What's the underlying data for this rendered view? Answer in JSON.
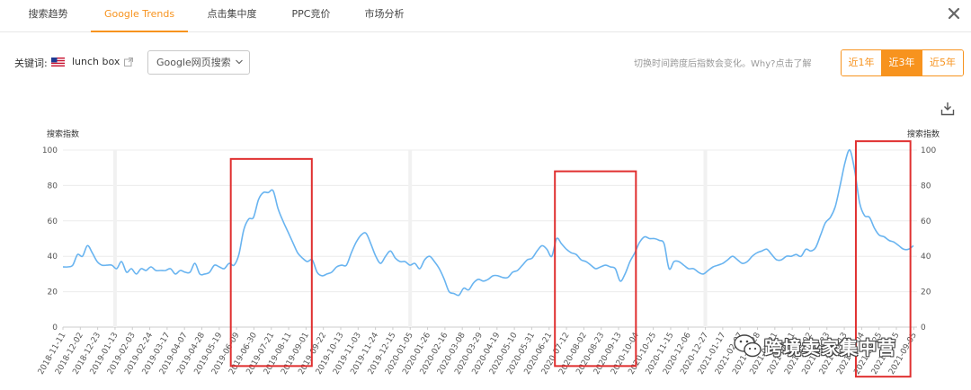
{
  "tabs": [
    {
      "label": "搜索趋势",
      "active": false
    },
    {
      "label": "Google Trends",
      "active": true
    },
    {
      "label": "点击集中度",
      "active": false
    },
    {
      "label": "PPC竞价",
      "active": false
    },
    {
      "label": "市场分析",
      "active": false
    }
  ],
  "toolbar": {
    "keyword_label": "关键词:",
    "keyword_value": "lunch box",
    "source_select": "Google网页搜索",
    "hint_text": "切换时间跨度后指数会变化。Why?",
    "hint_link": "点击了解",
    "ranges": [
      {
        "label": "近1年",
        "active": false
      },
      {
        "label": "近3年",
        "active": true
      },
      {
        "label": "近5年",
        "active": false
      }
    ]
  },
  "icons": {
    "close": "close-icon",
    "flag": "us-flag-icon",
    "external": "external-link-icon",
    "caret": "chevron-down-icon",
    "download": "download-icon"
  },
  "colors": {
    "accent": "#f7931e",
    "line": "#69b4f0",
    "highlight_box": "#e03030"
  },
  "chart_data": {
    "type": "line",
    "ylabel_left": "搜索指数",
    "ylabel_right": "搜索指数",
    "ylim": [
      0,
      100
    ],
    "yticks": [
      0,
      20,
      40,
      60,
      80,
      100
    ],
    "grid": true,
    "x_tick_labels": [
      "2018-11-11",
      "2018-12-02",
      "2018-12-23",
      "2019-01-13",
      "2019-02-03",
      "2019-02-24",
      "2019-03-17",
      "2019-04-07",
      "2019-04-28",
      "2019-05-19",
      "2019-06-09",
      "2019-06-30",
      "2019-07-21",
      "2019-08-11",
      "2019-09-01",
      "2019-09-22",
      "2019-10-13",
      "2019-11-03",
      "2019-11-24",
      "2019-12-15",
      "2020-01-05",
      "2020-01-26",
      "2020-02-16",
      "2020-03-08",
      "2020-03-29",
      "2020-04-19",
      "2020-05-10",
      "2020-05-31",
      "2020-06-21",
      "2020-07-12",
      "2020-08-02",
      "2020-08-23",
      "2020-09-13",
      "2020-10-04",
      "2020-10-25",
      "2020-11-15",
      "2020-12-06",
      "2020-12-27",
      "2021-01-17",
      "2021-02-07",
      "2021-02-28",
      "2021-03-21",
      "2021-04-11",
      "2021-05-02",
      "2021-05-23",
      "2021-06-13",
      "2021-07-04",
      "2021-07-25",
      "2021-08-15",
      "2021-09-05"
    ],
    "series": [
      {
        "values": [
          34,
          34,
          35,
          41,
          40,
          46,
          42,
          37,
          35,
          35,
          35,
          33,
          37,
          31,
          33,
          30,
          33,
          32,
          34,
          32,
          32,
          32,
          33,
          30,
          32,
          31,
          31,
          36,
          30,
          30,
          31,
          35,
          34,
          33,
          36,
          35,
          41,
          55,
          61,
          62,
          72,
          76,
          76,
          77,
          67,
          60,
          54,
          48,
          42,
          39,
          37,
          38,
          31,
          29,
          30,
          31,
          34,
          35,
          35,
          42,
          48,
          52,
          53,
          47,
          40,
          36,
          40,
          43,
          39,
          37,
          37,
          35,
          36,
          33,
          38,
          40,
          37,
          33,
          27,
          20,
          19,
          18,
          22,
          21,
          25,
          27,
          26,
          27,
          29,
          29,
          28,
          28,
          31,
          32,
          35,
          38,
          39,
          43,
          46,
          44,
          40,
          50,
          47,
          44,
          42,
          41,
          38,
          37,
          35,
          33,
          34,
          35,
          34,
          33,
          26,
          30,
          37,
          42,
          48,
          51,
          50,
          50,
          49,
          47,
          33,
          37,
          37,
          35,
          33,
          33,
          31,
          30,
          32,
          34,
          35,
          36,
          38,
          40,
          38,
          36,
          37,
          40,
          42,
          43,
          44,
          41,
          38,
          38,
          40,
          40,
          41,
          40,
          44,
          43,
          45,
          52,
          59,
          62,
          68,
          80,
          93,
          100,
          88,
          70,
          63,
          62,
          56,
          52,
          51,
          49,
          48,
          46,
          44,
          44,
          46
        ]
      }
    ],
    "highlight_regions": [
      {
        "from": "2019-06-02",
        "to": "2019-09-08",
        "y_from": -22,
        "y_to": 95
      },
      {
        "from": "2020-06-28",
        "to": "2020-10-04",
        "y_from": -22,
        "y_to": 88
      },
      {
        "from": "2021-06-27",
        "to": "2021-09-01",
        "y_from": -28,
        "y_to": 105
      }
    ],
    "gap_markers": [
      "2019-01-13",
      "2020-01-05",
      "2020-12-27"
    ]
  },
  "watermark": {
    "text": "跨境卖家集中营",
    "icon": "wechat-icon"
  }
}
